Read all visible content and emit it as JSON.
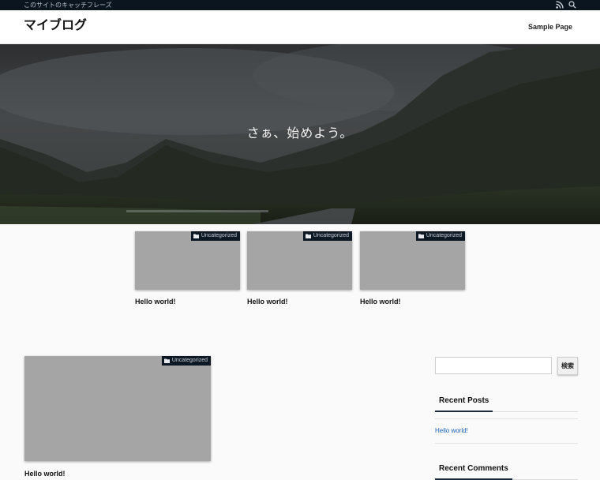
{
  "topbar": {
    "tagline": "このサイトのキャッチフレーズ",
    "icons": [
      "rss-icon",
      "search-icon"
    ]
  },
  "header": {
    "site_title": "マイブログ",
    "nav": [
      {
        "label": "Sample Page"
      }
    ]
  },
  "hero": {
    "text": "さぁ、始めよう。"
  },
  "featured_posts": [
    {
      "category": "Uncategorized",
      "title": "Hello world!"
    },
    {
      "category": "Uncategorized",
      "title": "Hello world!"
    },
    {
      "category": "Uncategorized",
      "title": "Hello world!"
    }
  ],
  "main_post": {
    "category": "Uncategorized",
    "title": "Hello world!"
  },
  "sidebar": {
    "search": {
      "placeholder": "",
      "button_label": "検索"
    },
    "recent_posts": {
      "title": "Recent Posts",
      "items": [
        "Hello world!"
      ]
    },
    "recent_comments": {
      "title": "Recent Comments"
    }
  },
  "colors": {
    "topbar_bg": "#0a1520",
    "badge_bg": "#0c1824",
    "link": "#1a5fb4",
    "thumbnail_placeholder": "#a5a5a5"
  }
}
